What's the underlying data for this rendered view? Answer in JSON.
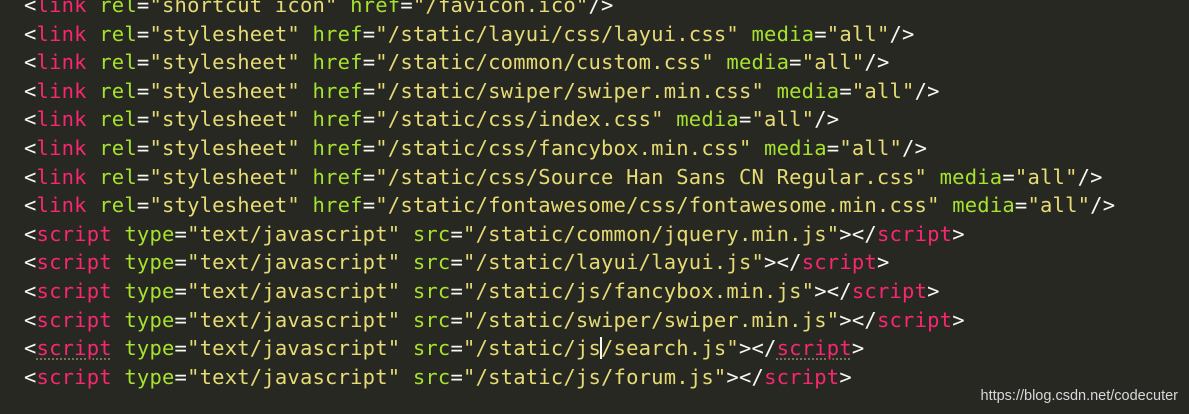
{
  "editor": {
    "lines": [
      [
        [
          "punct",
          "<"
        ],
        [
          "tag",
          "link"
        ],
        [
          "punct",
          " "
        ],
        [
          "attr",
          "rel"
        ],
        [
          "punct",
          "="
        ],
        [
          "str",
          "\"shortcut icon\""
        ],
        [
          "punct",
          " "
        ],
        [
          "attr",
          "href"
        ],
        [
          "punct",
          "="
        ],
        [
          "str",
          "\"/favicon.ico\""
        ],
        [
          "punct",
          "/>"
        ]
      ],
      [
        [
          "punct",
          "<"
        ],
        [
          "tag",
          "link"
        ],
        [
          "punct",
          " "
        ],
        [
          "attr",
          "rel"
        ],
        [
          "punct",
          "="
        ],
        [
          "str",
          "\"stylesheet\""
        ],
        [
          "punct",
          " "
        ],
        [
          "attr",
          "href"
        ],
        [
          "punct",
          "="
        ],
        [
          "str",
          "\"/static/layui/css/layui.css\""
        ],
        [
          "punct",
          " "
        ],
        [
          "attr",
          "media"
        ],
        [
          "punct",
          "="
        ],
        [
          "str",
          "\"all\""
        ],
        [
          "punct",
          "/>"
        ]
      ],
      [
        [
          "punct",
          "<"
        ],
        [
          "tag",
          "link"
        ],
        [
          "punct",
          " "
        ],
        [
          "attr",
          "rel"
        ],
        [
          "punct",
          "="
        ],
        [
          "str",
          "\"stylesheet\""
        ],
        [
          "punct",
          " "
        ],
        [
          "attr",
          "href"
        ],
        [
          "punct",
          "="
        ],
        [
          "str",
          "\"/static/common/custom.css\""
        ],
        [
          "punct",
          " "
        ],
        [
          "attr",
          "media"
        ],
        [
          "punct",
          "="
        ],
        [
          "str",
          "\"all\""
        ],
        [
          "punct",
          "/>"
        ]
      ],
      [
        [
          "punct",
          "<"
        ],
        [
          "tag",
          "link"
        ],
        [
          "punct",
          " "
        ],
        [
          "attr",
          "rel"
        ],
        [
          "punct",
          "="
        ],
        [
          "str",
          "\"stylesheet\""
        ],
        [
          "punct",
          " "
        ],
        [
          "attr",
          "href"
        ],
        [
          "punct",
          "="
        ],
        [
          "str",
          "\"/static/swiper/swiper.min.css\""
        ],
        [
          "punct",
          " "
        ],
        [
          "attr",
          "media"
        ],
        [
          "punct",
          "="
        ],
        [
          "str",
          "\"all\""
        ],
        [
          "punct",
          "/>"
        ]
      ],
      [
        [
          "punct",
          "<"
        ],
        [
          "tag",
          "link"
        ],
        [
          "punct",
          " "
        ],
        [
          "attr",
          "rel"
        ],
        [
          "punct",
          "="
        ],
        [
          "str",
          "\"stylesheet\""
        ],
        [
          "punct",
          " "
        ],
        [
          "attr",
          "href"
        ],
        [
          "punct",
          "="
        ],
        [
          "str",
          "\"/static/css/index.css\""
        ],
        [
          "punct",
          " "
        ],
        [
          "attr",
          "media"
        ],
        [
          "punct",
          "="
        ],
        [
          "str",
          "\"all\""
        ],
        [
          "punct",
          "/>"
        ]
      ],
      [
        [
          "punct",
          "<"
        ],
        [
          "tag",
          "link"
        ],
        [
          "punct",
          " "
        ],
        [
          "attr",
          "rel"
        ],
        [
          "punct",
          "="
        ],
        [
          "str",
          "\"stylesheet\""
        ],
        [
          "punct",
          " "
        ],
        [
          "attr",
          "href"
        ],
        [
          "punct",
          "="
        ],
        [
          "str",
          "\"/static/css/fancybox.min.css\""
        ],
        [
          "punct",
          " "
        ],
        [
          "attr",
          "media"
        ],
        [
          "punct",
          "="
        ],
        [
          "str",
          "\"all\""
        ],
        [
          "punct",
          "/>"
        ]
      ],
      [
        [
          "punct",
          "<"
        ],
        [
          "tag",
          "link"
        ],
        [
          "punct",
          " "
        ],
        [
          "attr",
          "rel"
        ],
        [
          "punct",
          "="
        ],
        [
          "str",
          "\"stylesheet\""
        ],
        [
          "punct",
          " "
        ],
        [
          "attr",
          "href"
        ],
        [
          "punct",
          "="
        ],
        [
          "str",
          "\"/static/css/Source Han Sans CN Regular.css\""
        ],
        [
          "punct",
          " "
        ],
        [
          "attr",
          "media"
        ],
        [
          "punct",
          "="
        ],
        [
          "str",
          "\"all\""
        ],
        [
          "punct",
          "/>"
        ]
      ],
      [
        [
          "punct",
          "<"
        ],
        [
          "tag",
          "link"
        ],
        [
          "punct",
          " "
        ],
        [
          "attr",
          "rel"
        ],
        [
          "punct",
          "="
        ],
        [
          "str",
          "\"stylesheet\""
        ],
        [
          "punct",
          " "
        ],
        [
          "attr",
          "href"
        ],
        [
          "punct",
          "="
        ],
        [
          "str",
          "\"/static/fontawesome/css/fontawesome.min.css\""
        ],
        [
          "punct",
          " "
        ],
        [
          "attr",
          "media"
        ],
        [
          "punct",
          "="
        ],
        [
          "str",
          "\"all\""
        ],
        [
          "punct",
          "/>"
        ]
      ],
      [
        [
          "punct",
          "<"
        ],
        [
          "tag",
          "script"
        ],
        [
          "punct",
          " "
        ],
        [
          "attr",
          "type"
        ],
        [
          "punct",
          "="
        ],
        [
          "str",
          "\"text/javascript\""
        ],
        [
          "punct",
          " "
        ],
        [
          "attr",
          "src"
        ],
        [
          "punct",
          "="
        ],
        [
          "str",
          "\"/static/common/jquery.min.js\""
        ],
        [
          "punct",
          "></"
        ],
        [
          "tag",
          "script"
        ],
        [
          "punct",
          ">"
        ]
      ],
      [
        [
          "punct",
          "<"
        ],
        [
          "tag",
          "script"
        ],
        [
          "punct",
          " "
        ],
        [
          "attr",
          "type"
        ],
        [
          "punct",
          "="
        ],
        [
          "str",
          "\"text/javascript\""
        ],
        [
          "punct",
          " "
        ],
        [
          "attr",
          "src"
        ],
        [
          "punct",
          "="
        ],
        [
          "str",
          "\"/static/layui/layui.js\""
        ],
        [
          "punct",
          "></"
        ],
        [
          "tag",
          "script"
        ],
        [
          "punct",
          ">"
        ]
      ],
      [
        [
          "punct",
          "<"
        ],
        [
          "tag",
          "script"
        ],
        [
          "punct",
          " "
        ],
        [
          "attr",
          "type"
        ],
        [
          "punct",
          "="
        ],
        [
          "str",
          "\"text/javascript\""
        ],
        [
          "punct",
          " "
        ],
        [
          "attr",
          "src"
        ],
        [
          "punct",
          "="
        ],
        [
          "str",
          "\"/static/js/fancybox.min.js\""
        ],
        [
          "punct",
          "></"
        ],
        [
          "tag",
          "script"
        ],
        [
          "punct",
          ">"
        ]
      ],
      [
        [
          "punct",
          "<"
        ],
        [
          "tag",
          "script"
        ],
        [
          "punct",
          " "
        ],
        [
          "attr",
          "type"
        ],
        [
          "punct",
          "="
        ],
        [
          "str",
          "\"text/javascript\""
        ],
        [
          "punct",
          " "
        ],
        [
          "attr",
          "src"
        ],
        [
          "punct",
          "="
        ],
        [
          "str",
          "\"/static/swiper/swiper.min.js\""
        ],
        [
          "punct",
          "></"
        ],
        [
          "tag",
          "script"
        ],
        [
          "punct",
          ">"
        ]
      ],
      [
        [
          "punct",
          "<"
        ],
        [
          "tag",
          "script",
          "squiggle"
        ],
        [
          "punct",
          " "
        ],
        [
          "attr",
          "type"
        ],
        [
          "punct",
          "="
        ],
        [
          "str",
          "\"text/javascript\""
        ],
        [
          "punct",
          " "
        ],
        [
          "attr",
          "src"
        ],
        [
          "punct",
          "="
        ],
        [
          "str",
          "\"/static/js"
        ],
        [
          "cursor",
          ""
        ],
        [
          "str",
          "/search.js\""
        ],
        [
          "punct",
          "></"
        ],
        [
          "tag",
          "script",
          "squiggle"
        ],
        [
          "punct",
          ">"
        ]
      ],
      [
        [
          "punct",
          "<"
        ],
        [
          "tag",
          "script"
        ],
        [
          "punct",
          " "
        ],
        [
          "attr",
          "type"
        ],
        [
          "punct",
          "="
        ],
        [
          "str",
          "\"text/javascript\""
        ],
        [
          "punct",
          " "
        ],
        [
          "attr",
          "src"
        ],
        [
          "punct",
          "="
        ],
        [
          "str",
          "\"/static/js/forum.js\""
        ],
        [
          "punct",
          "></"
        ],
        [
          "tag",
          "script"
        ],
        [
          "punct",
          ">"
        ]
      ]
    ]
  },
  "colors": {
    "background": "#272822",
    "punct": "#f8f8f2",
    "tag": "#f92672",
    "attr": "#a6e22e",
    "str": "#e6db74"
  },
  "watermark": {
    "text": "https://blog.csdn.net/codecuter"
  }
}
